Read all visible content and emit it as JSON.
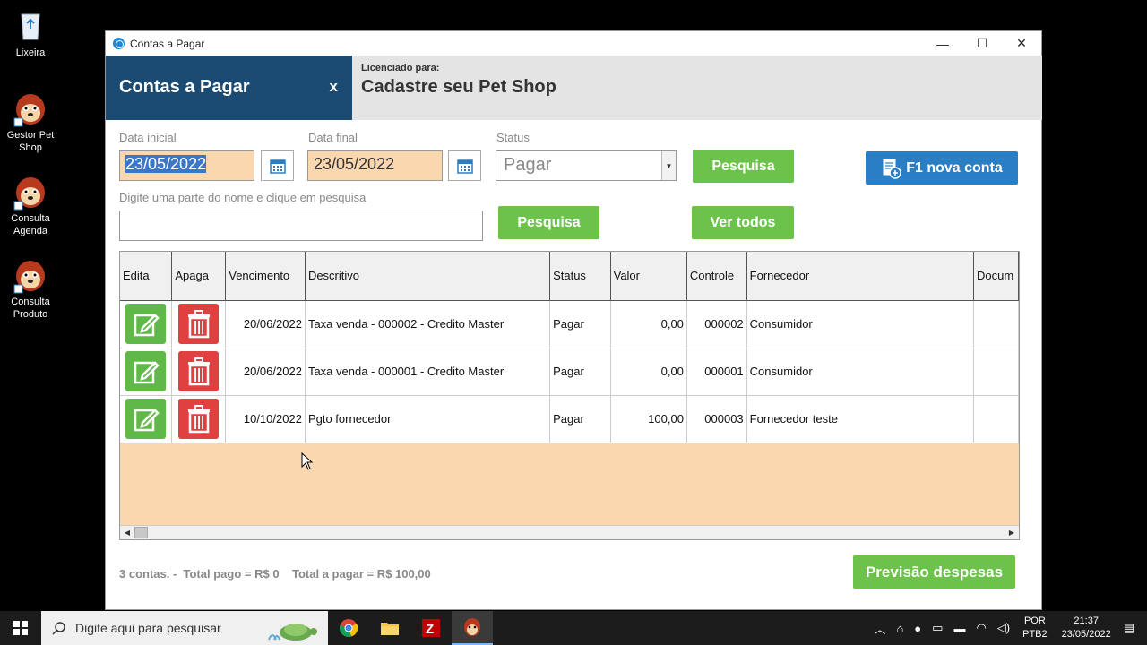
{
  "desktop": {
    "icons": [
      {
        "label": "Lixeira"
      },
      {
        "label": "Gestor Pet Shop"
      },
      {
        "label": "Consulta Agenda"
      },
      {
        "label": "Consulta Produto"
      }
    ]
  },
  "window": {
    "title": "Contas a Pagar",
    "controls": {
      "minimize": "—",
      "maximize": "☐",
      "close": "✕"
    }
  },
  "header": {
    "title": "Contas a Pagar",
    "close_label": "x",
    "license_label": "Licenciado para:",
    "license_name": "Cadastre seu Pet Shop"
  },
  "filters": {
    "date_start_label": "Data inicial",
    "date_start_value": "23/05/2022",
    "date_end_label": "Data final",
    "date_end_value": "23/05/2022",
    "status_label": "Status",
    "status_value": "Pagar",
    "search_btn": "Pesquisa",
    "new_account_btn": "F1 nova conta",
    "name_search_label": "Digite uma parte do nome e clique em pesquisa",
    "name_search_value": "",
    "name_search_btn": "Pesquisa",
    "view_all_btn": "Ver todos"
  },
  "table": {
    "headers": [
      "Edita",
      "Apaga",
      "Vencimento",
      "Descritivo",
      "Status",
      "Valor",
      "Controle",
      "Fornecedor",
      "Docum"
    ],
    "rows": [
      {
        "vencimento": "20/06/2022",
        "descritivo": "Taxa venda - 000002 - Credito Master",
        "status": "Pagar",
        "valor": "0,00",
        "controle": "000002",
        "fornecedor": "Consumidor"
      },
      {
        "vencimento": "20/06/2022",
        "descritivo": "Taxa venda - 000001 - Credito Master",
        "status": "Pagar",
        "valor": "0,00",
        "controle": "000001",
        "fornecedor": "Consumidor"
      },
      {
        "vencimento": "10/10/2022",
        "descritivo": "Pgto fornecedor",
        "status": "Pagar",
        "valor": "100,00",
        "controle": "000003",
        "fornecedor": "Fornecedor teste"
      }
    ]
  },
  "footer": {
    "summary": "3 contas. -  Total pago = R$ 0    Total a pagar = R$ 100,00",
    "forecast_btn": "Previsão despesas"
  },
  "taskbar": {
    "search_placeholder": "Digite aqui para pesquisar",
    "lang_1": "POR",
    "lang_2": "PTB2",
    "time": "21:37",
    "date": "23/05/2022"
  },
  "colors": {
    "header_blue": "#1b4a73",
    "green_button": "#6cc24a",
    "blue_button": "#2a7ec4",
    "date_field": "#fbd7b0",
    "delete_red": "#e04040"
  }
}
